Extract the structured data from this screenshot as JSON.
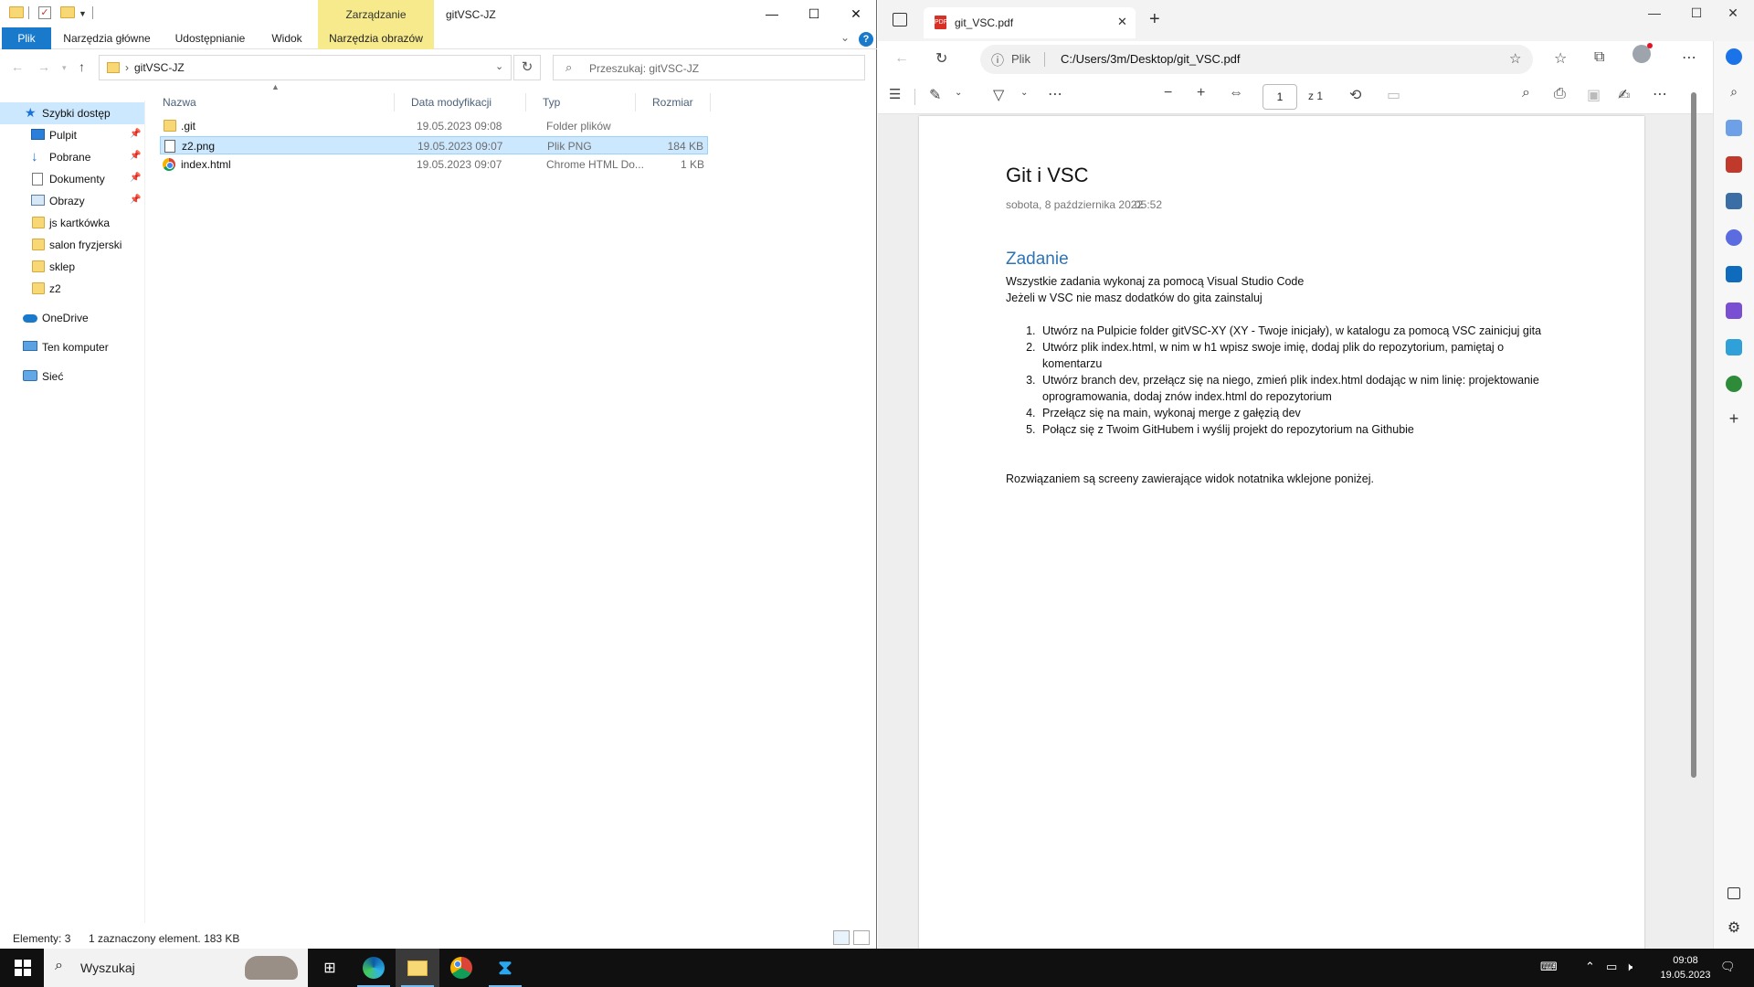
{
  "explorer": {
    "title": "gitVSC-JZ",
    "context_tab_group": "Zarządzanie",
    "ribbon_tabs": [
      "Plik",
      "Narzędzia główne",
      "Udostępnianie",
      "Widok",
      "Narzędzia obrazów"
    ],
    "address_path": "gitVSC-JZ",
    "search_placeholder": "Przeszukaj: gitVSC-JZ",
    "nav": {
      "quick_access": "Szybki dostęp",
      "items": [
        "Pulpit",
        "Pobrane",
        "Dokumenty",
        "Obrazy",
        "js kartkówka",
        "salon fryzjerski",
        "sklep",
        "z2"
      ],
      "onedrive": "OneDrive",
      "this_pc": "Ten komputer",
      "network": "Sieć"
    },
    "columns": [
      "Nazwa",
      "Data modyfikacji",
      "Typ",
      "Rozmiar"
    ],
    "files": [
      {
        "name": ".git",
        "date": "19.05.2023 09:08",
        "type": "Folder plików",
        "size": "",
        "icon": "folder-icon"
      },
      {
        "name": "z2.png",
        "date": "19.05.2023 09:07",
        "type": "Plik PNG",
        "size": "184 KB",
        "icon": "png-file-icon",
        "selected": true
      },
      {
        "name": "index.html",
        "date": "19.05.2023 09:07",
        "type": "Chrome HTML Do...",
        "size": "1 KB",
        "icon": "chrome-html-icon"
      }
    ],
    "status": {
      "count": "Elementy: 3",
      "selection": "1 zaznaczony element. 183 KB"
    }
  },
  "edge": {
    "tab_title": "git_VSC.pdf",
    "url_scheme_label": "Plik",
    "url": "C:/Users/3m/Desktop/git_VSC.pdf",
    "page_number": "1",
    "page_total": "z 1",
    "pdf": {
      "title": "Git i VSC",
      "date": "sobota, 8 października 2022",
      "time": "05:52",
      "heading": "Zadanie",
      "line1": "Wszystkie zadania wykonaj za pomocą Visual Studio Code",
      "line2": "Jeżeli w VSC nie masz dodatków do gita zainstaluj",
      "steps": [
        "Utwórz na Pulpicie folder gitVSC-XY (XY - Twoje inicjały), w katalogu za pomocą VSC zainicjuj gita",
        "Utwórz plik index.html, w nim w h1 wpisz swoje imię, dodaj plik do repozytorium, pamiętaj o komentarzu",
        "Utwórz branch dev, przełącz się na niego, zmień plik index.html dodając w nim linię: projektowanie oprogramowania, dodaj znów index.html do repozytorium",
        "Przełącz się na main, wykonaj merge z gałęzią dev",
        "Połącz się z Twoim GitHubem i wyślij projekt do repozytorium na Githubie"
      ],
      "footer": "Rozwiązaniem są screeny zawierające widok notatnika wklejone poniżej."
    }
  },
  "taskbar": {
    "search_placeholder": "Wyszukaj",
    "time": "09:08",
    "date": "19.05.2023"
  }
}
